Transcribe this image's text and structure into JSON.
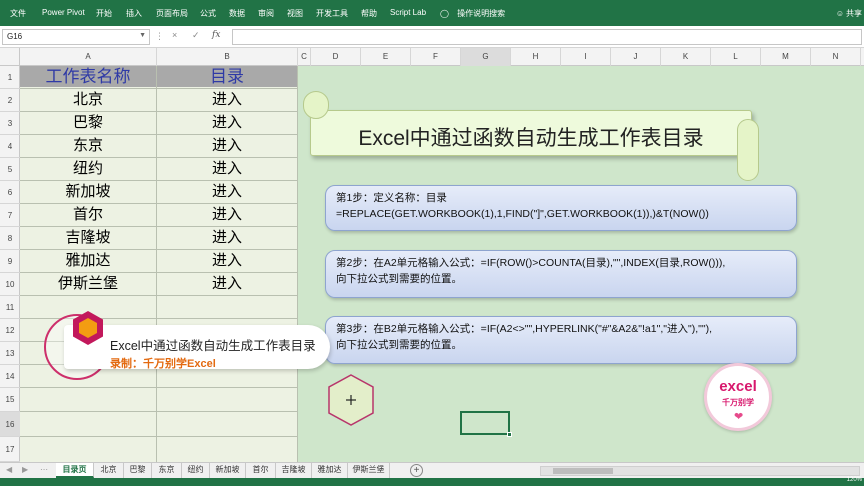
{
  "ribbon": {
    "tabs": [
      "文件",
      "Power Pivot",
      "开始",
      "插入",
      "页面布局",
      "公式",
      "数据",
      "审阅",
      "视图",
      "开发工具",
      "帮助",
      "Script Lab"
    ],
    "tell_me": "操作说明搜索",
    "share": "共享"
  },
  "formula_bar": {
    "name_box": "G16",
    "cancel": "×",
    "enter": "✓",
    "fx": "fx",
    "value": ""
  },
  "columns": [
    "A",
    "B",
    "C",
    "D",
    "E",
    "F",
    "G",
    "H",
    "I",
    "J",
    "K",
    "L",
    "M",
    "N"
  ],
  "rows": [
    "1",
    "2",
    "3",
    "4",
    "5",
    "6",
    "7",
    "8",
    "9",
    "10",
    "11",
    "12",
    "13",
    "14",
    "15",
    "16",
    "17"
  ],
  "table": {
    "header_a": "工作表名称",
    "header_b": "目录",
    "sheet_names": [
      "北京",
      "巴黎",
      "东京",
      "纽约",
      "新加坡",
      "首尔",
      "吉隆坡",
      "雅加达",
      "伊斯兰堡"
    ],
    "link_text": "进入"
  },
  "title": "Excel中通过函数自动生成工作表目录",
  "steps": [
    {
      "line1": "第1步：定义名称：目录",
      "line2": "=REPLACE(GET.WORKBOOK(1),1,FIND(\"]\",GET.WORKBOOK(1)),)&T(NOW())"
    },
    {
      "line1": "第2步：在A2单元格输入公式：=IF(ROW()>COUNTA(目录),\"\",INDEX(目录,ROW())),",
      "line2": "向下拉公式到需要的位置。"
    },
    {
      "line1": "第3步：在B2单元格输入公式：=IF(A2<>\"\",HYPERLINK(\"#\"&A2&\"!a1\",\"进入\"),\"\"),",
      "line2": "向下拉公式到需要的位置。"
    }
  ],
  "logo": {
    "line1": "excel",
    "line2": "千万别学"
  },
  "banner": {
    "title": "Excel中通过函数自动生成工作表目录",
    "credit": "录制：千万别学Excel"
  },
  "sheet_tabs": [
    "目录页",
    "北京",
    "巴黎",
    "东京",
    "纽约",
    "新加坡",
    "首尔",
    "吉隆坡",
    "雅加达",
    "伊斯兰堡"
  ],
  "active_tab": "目录页",
  "status": {
    "zoom": "120%"
  },
  "colors": {
    "excel_green": "#217346",
    "sheet_bg": "#cfe6cb",
    "header_text": "#2f3aa6",
    "accent_pink": "#d8186d"
  }
}
